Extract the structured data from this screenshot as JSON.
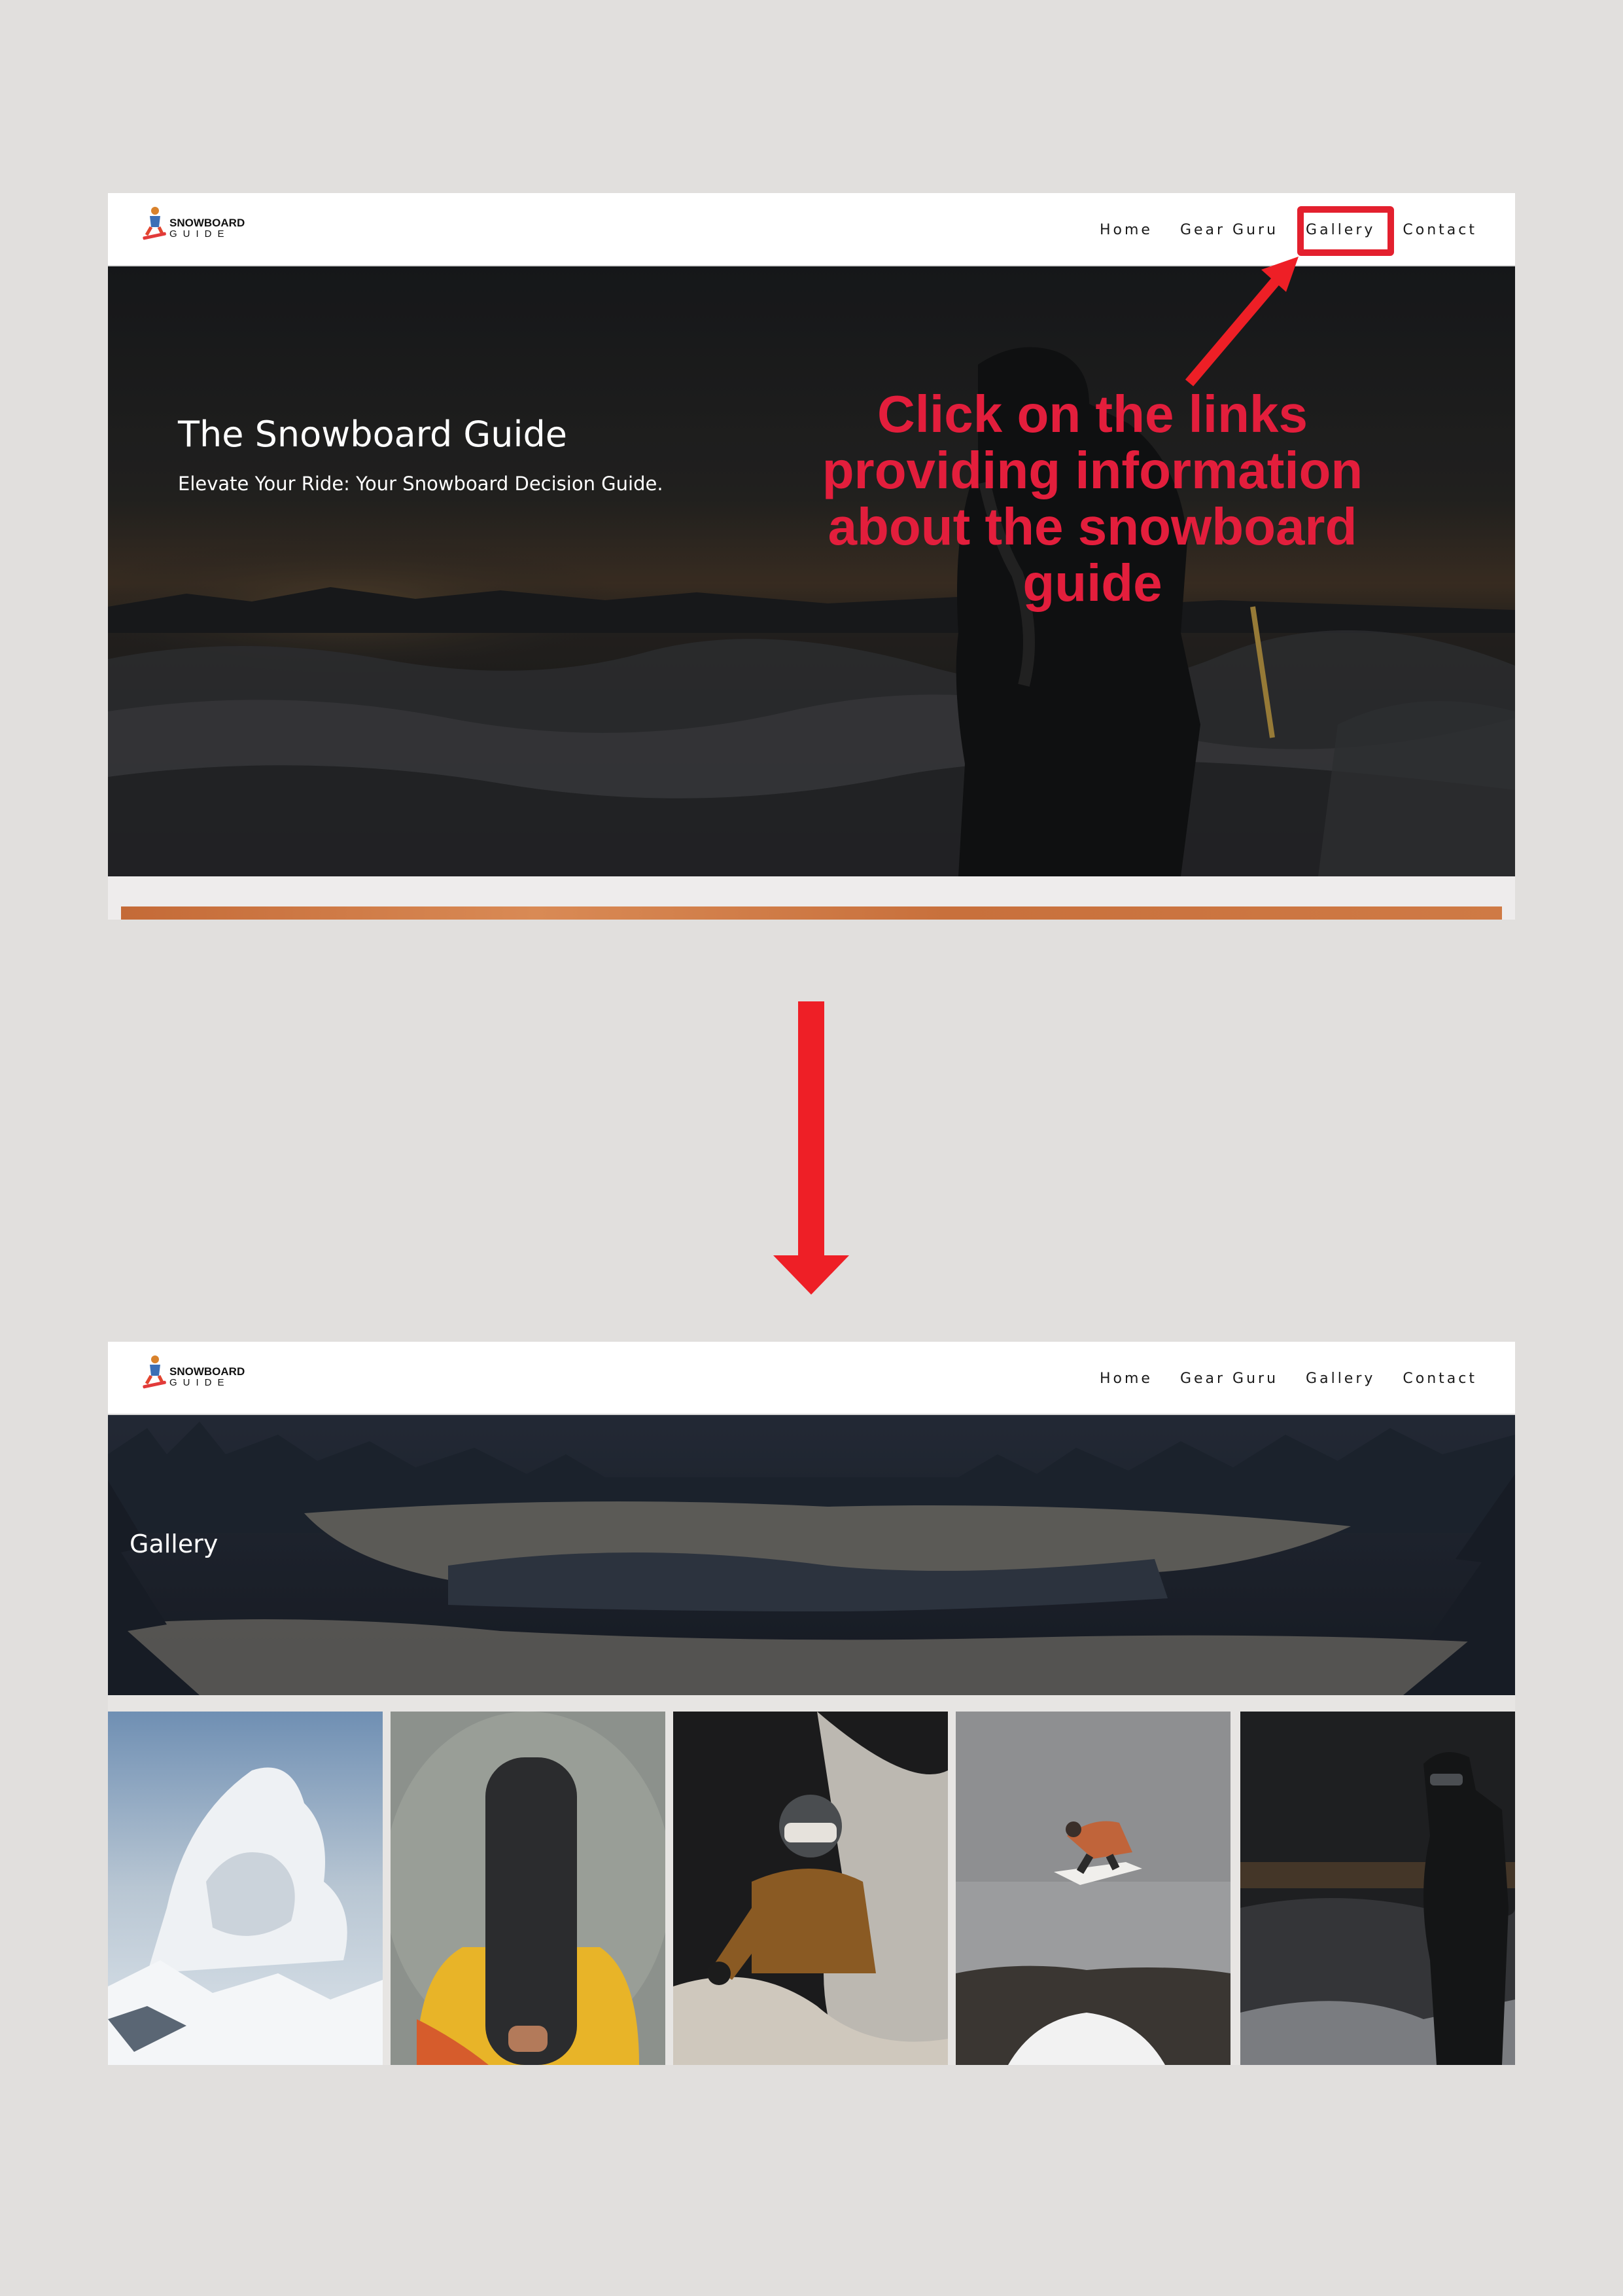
{
  "annotation": {
    "instruction": "Click on the links providing information about the snowboard guide",
    "highlighted_link": "Gallery"
  },
  "header": {
    "logo": {
      "line1": "SNOWBOARD",
      "line2": "GUIDE"
    },
    "nav": [
      {
        "label": "Home"
      },
      {
        "label": "Gear Guru"
      },
      {
        "label": "Gallery"
      },
      {
        "label": "Contact"
      }
    ]
  },
  "hero": {
    "title": "The Snowboard Guide",
    "subtitle": "Elevate Your Ride: Your Snowboard Decision Guide."
  },
  "gallery_page": {
    "title": "Gallery",
    "photos": [
      {
        "subject": "avalanche"
      },
      {
        "subject": "person-holding-snowboard"
      },
      {
        "subject": "snowboarder-in-powder"
      },
      {
        "subject": "snowboard-jump"
      },
      {
        "subject": "snowboarder-at-sunset"
      }
    ]
  },
  "colors": {
    "annotation_red": "#e31e3c",
    "arrow_red": "#ee1f26",
    "page_background": "#e1dfdd"
  }
}
